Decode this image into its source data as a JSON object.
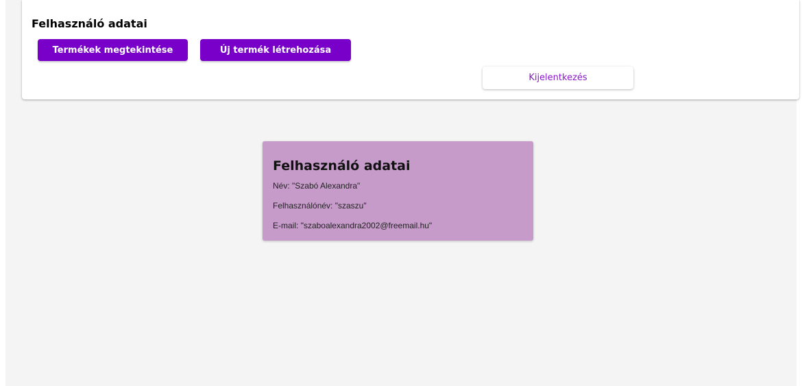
{
  "header": {
    "title": "Felhasználó adatai",
    "buttons": {
      "view_products": "Termékek megtekintése",
      "new_product": "Új termék létrehozása",
      "logout": "Kijelentkezés"
    }
  },
  "user_card": {
    "title": "Felhasználó adatai",
    "name_label": "Név:",
    "name_value": "\"Szabó Alexandra\"",
    "username_label": "Felhasználónév:",
    "username_value": "\"szaszu\"",
    "email_label": "E-mail:",
    "email_value": "\"szaboalexandra2002@freemail.hu\""
  },
  "colors": {
    "primary_button": "#7800c8",
    "logout_text": "#8a18c9",
    "card_background": "#c69bca",
    "page_background": "#f4f4f4"
  }
}
